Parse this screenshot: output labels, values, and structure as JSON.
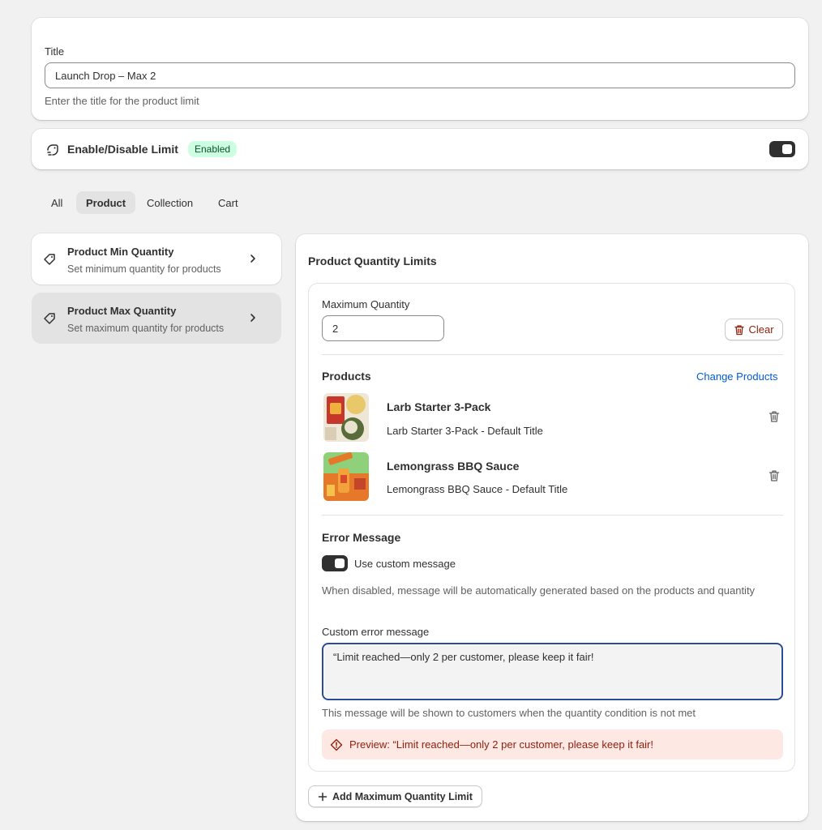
{
  "title_field": {
    "label": "Title",
    "value": "Launch Drop – Max 2",
    "help": "Enter the title for the product limit"
  },
  "enable": {
    "label": "Enable/Disable Limit",
    "badge": "Enabled",
    "toggle_on": true
  },
  "tabs": [
    {
      "label": "All"
    },
    {
      "label": "Product",
      "active": true
    },
    {
      "label": "Collection"
    },
    {
      "label": "Cart"
    }
  ],
  "sidebar": {
    "items": [
      {
        "title": "Product Min Quantity",
        "subtitle": "Set minimum quantity for products"
      },
      {
        "title": "Product Max Quantity",
        "subtitle": "Set maximum quantity for products",
        "selected": true
      }
    ]
  },
  "panel": {
    "title": "Product Quantity Limits",
    "max_qty_label": "Maximum Quantity",
    "max_qty_value": "2",
    "clear_label": "Clear",
    "products_title": "Products",
    "change_products": "Change Products",
    "products": [
      {
        "name": "Larb Starter 3-Pack",
        "variant": "Larb Starter 3-Pack - Default Title"
      },
      {
        "name": "Lemongrass BBQ Sauce",
        "variant": "Lemongrass BBQ Sauce - Default Title"
      }
    ],
    "error_title": "Error Message",
    "use_custom_label": "Use custom message",
    "use_custom_on": true,
    "disabled_help": "When disabled, message will be automatically generated based on the products and quantity",
    "custom_label": "Custom error message",
    "custom_value": "“Limit reached—only 2 per customer, please keep it fair!",
    "custom_help": "This message will be shown to customers when the quantity condition is not met",
    "preview": "Preview: “Limit reached—only 2 per customer, please keep it fair!",
    "add_button": "Add Maximum Quantity Limit"
  },
  "colors": {
    "link": "#005bd3",
    "critical": "#8e1f0b",
    "success_bg": "#cdfee1",
    "preview_bg": "#fee8e4"
  }
}
